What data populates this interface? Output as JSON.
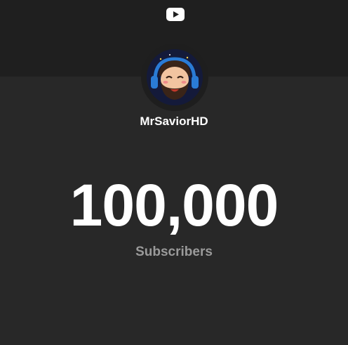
{
  "header": {
    "logo_icon": "youtube-play-icon"
  },
  "channel": {
    "name": "MrSaviorHD",
    "avatar_icon": "bearded-character-avatar"
  },
  "stats": {
    "subscriber_count": "100,000",
    "subscriber_label": "Subscribers"
  },
  "colors": {
    "background": "#282828",
    "header_band": "#1f1f1f",
    "primary_text": "#ffffff",
    "secondary_text": "#9a9a9a"
  }
}
